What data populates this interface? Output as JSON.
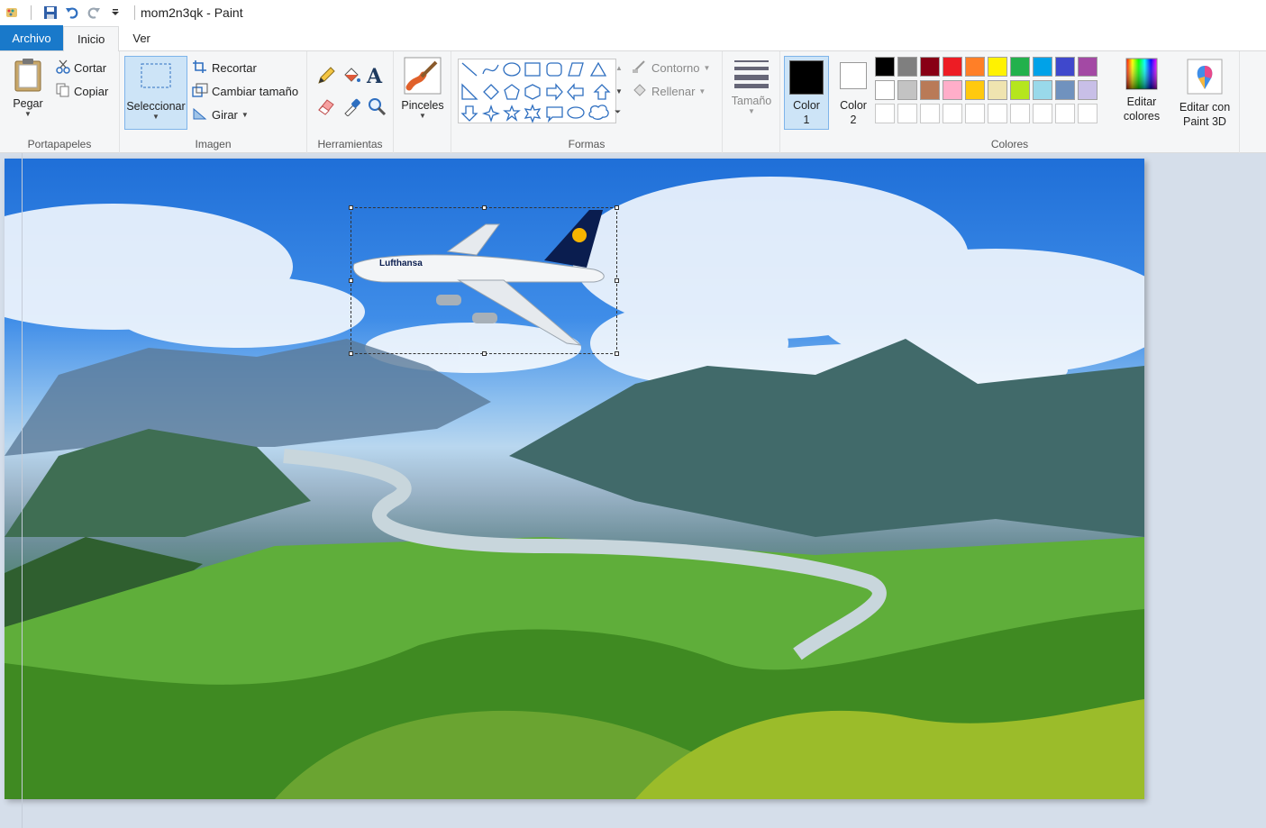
{
  "window": {
    "title": "mom2n3qk - Paint"
  },
  "tabs": [
    {
      "label": "Archivo"
    },
    {
      "label": "Inicio"
    },
    {
      "label": "Ver"
    }
  ],
  "clipboard": {
    "paste": "Pegar",
    "cut": "Cortar",
    "copy": "Copiar",
    "group": "Portapapeles"
  },
  "image": {
    "select": "Seleccionar",
    "crop": "Recortar",
    "resize": "Cambiar tamaño",
    "rotate": "Girar",
    "group": "Imagen"
  },
  "tools": {
    "group": "Herramientas"
  },
  "brushes": {
    "label": "Pinceles"
  },
  "shapes": {
    "outline": "Contorno",
    "fill": "Rellenar",
    "group": "Formas"
  },
  "size": {
    "label": "Tamaño"
  },
  "colors": {
    "color1": "Color 1",
    "color1_value": "#000000",
    "color2": "Color 2",
    "color2_value": "#ffffff",
    "edit": "Editar colores",
    "group": "Colores",
    "palette_row1": [
      "#000000",
      "#7f7f7f",
      "#880015",
      "#ed1c24",
      "#ff7f27",
      "#fff200",
      "#22b14c",
      "#00a2e8",
      "#3f48cc",
      "#a349a4"
    ],
    "palette_row2": [
      "#ffffff",
      "#c3c3c3",
      "#b97a57",
      "#ffaec9",
      "#ffc90e",
      "#efe4b0",
      "#b5e61d",
      "#99d9ea",
      "#7092be",
      "#c8bfe7"
    ]
  },
  "paint3d": {
    "label": "Editar con Paint 3D"
  },
  "canvas": {
    "airplane_livery": "Lufthansa"
  }
}
